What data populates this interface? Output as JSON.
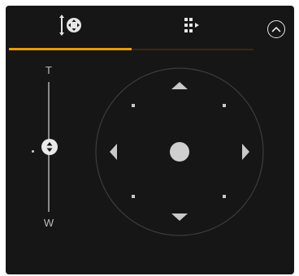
{
  "tabs": [
    {
      "name": "pan-tilt-zoom",
      "icon": "ptz-move-icon",
      "active": true
    },
    {
      "name": "presets",
      "icon": "preset-grid-icon",
      "active": false
    }
  ],
  "collapse": {
    "icon": "chevron-up-circle-icon"
  },
  "zoom": {
    "tele_label": "T",
    "wide_label": "W",
    "level": 0.5
  },
  "colors": {
    "background": "#161616",
    "accent": "#e59a12",
    "control": "#cfcfcf"
  }
}
